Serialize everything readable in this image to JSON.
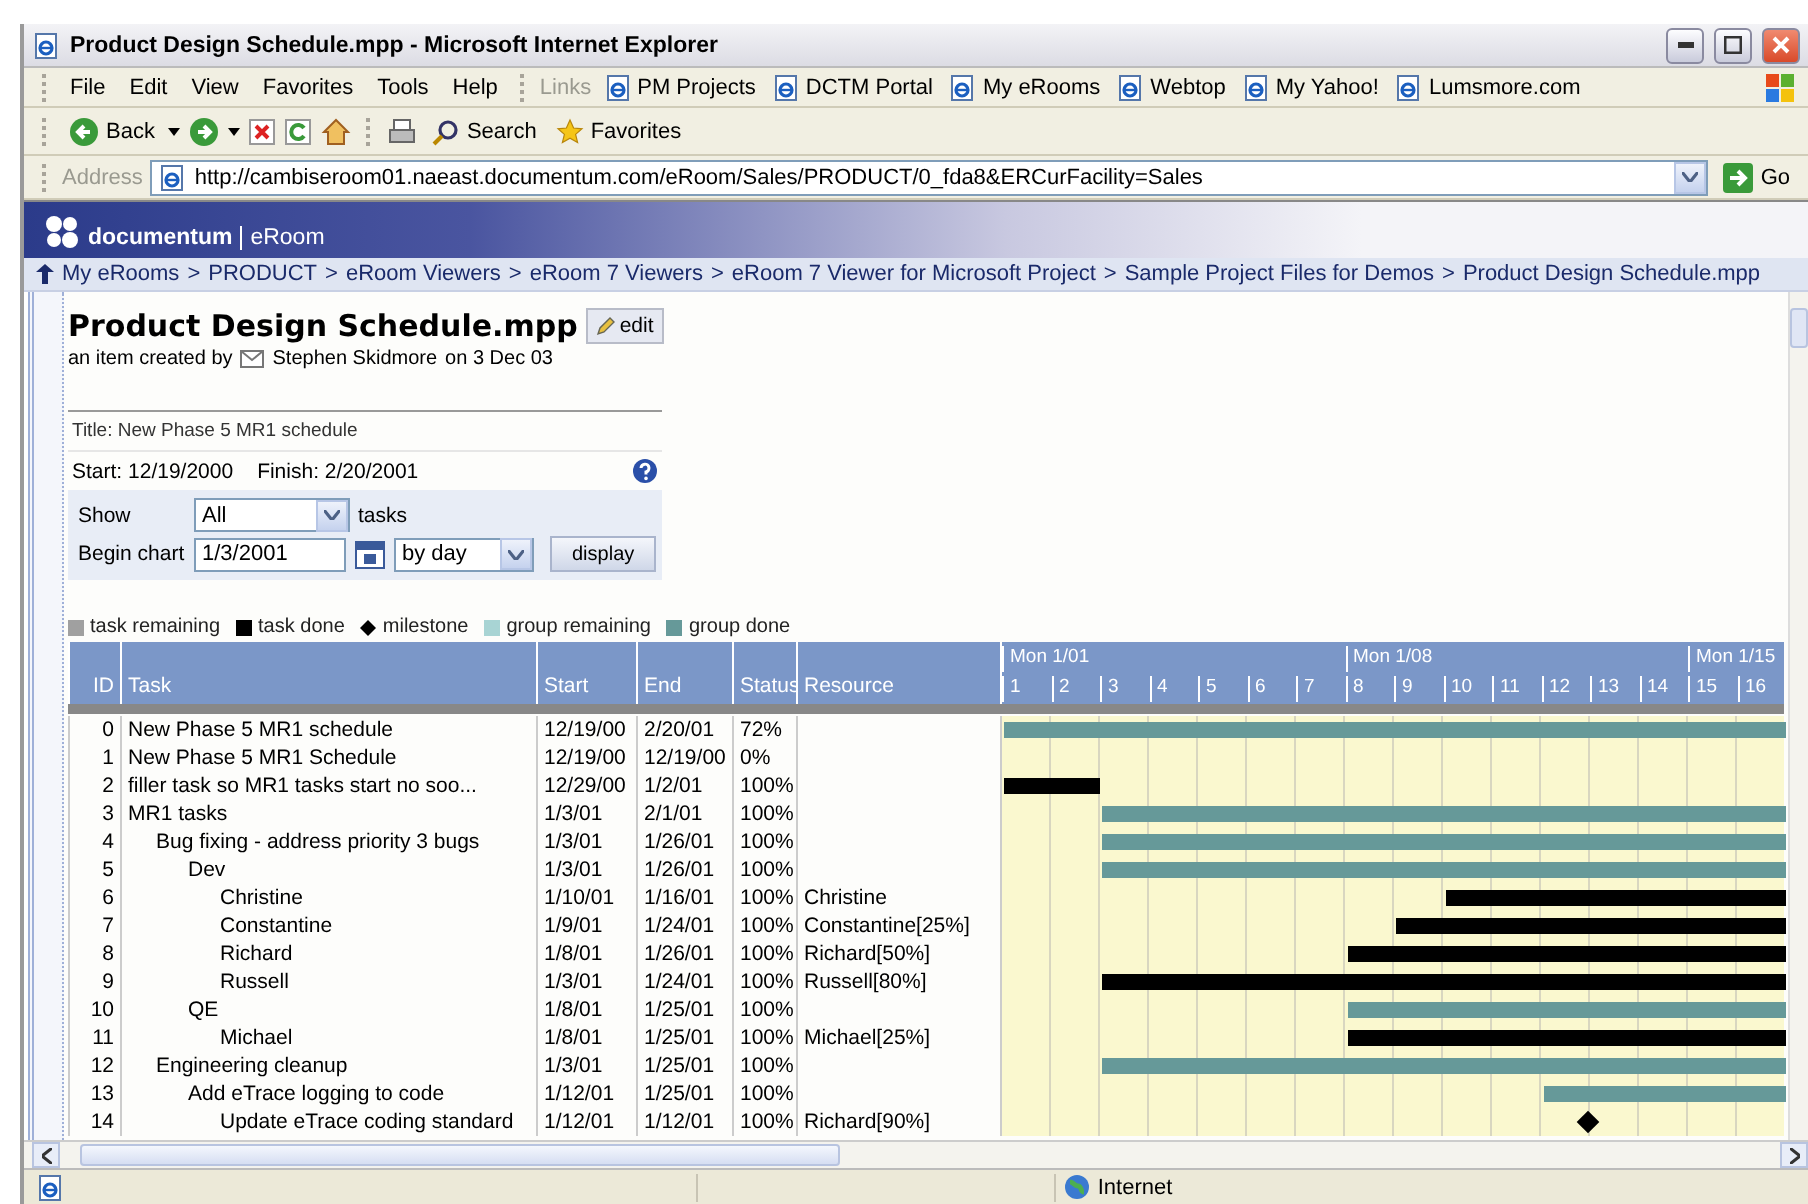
{
  "window": {
    "title": "Product Design Schedule.mpp - Microsoft Internet Explorer"
  },
  "menu": [
    "File",
    "Edit",
    "View",
    "Favorites",
    "Tools",
    "Help"
  ],
  "links": {
    "label": "Links",
    "items": [
      "PM Projects",
      "DCTM Portal",
      "My eRooms",
      "Webtop",
      "My Yahoo!",
      "Lumsmore.com"
    ]
  },
  "toolbar": {
    "back": "Back",
    "search": "Search",
    "favorites": "Favorites"
  },
  "address": {
    "label": "Address",
    "url": "http://cambiseroom01.naeast.documentum.com/eRoom/Sales/PRODUCT/0_fda8&ERCurFacility=Sales",
    "go": "Go"
  },
  "eroom": {
    "brand": "documentum",
    "product": "eRoom",
    "separator": ">",
    "breadcrumb": [
      "My eRooms",
      "PRODUCT",
      "eRoom Viewers",
      "eRoom 7 Viewers",
      "eRoom 7 Viewer for Microsoft Project",
      "Sample Project Files for Demos",
      "Product Design Schedule.mpp"
    ],
    "title": "Product Design Schedule.mpp",
    "edit": "edit",
    "created_by": "an item created by",
    "author": "Stephen Skidmore",
    "date": "on 3 Dec 03"
  },
  "project": {
    "title": "Title: New Phase 5 MR1 schedule",
    "start": "Start: 12/19/2000",
    "finish": "Finish: 2/20/2001",
    "show_label": "Show",
    "show_value": "All",
    "tasks_label": "tasks",
    "begin_label": "Begin chart",
    "begin_value": "1/3/2001",
    "scale_value": "by day",
    "display": "display"
  },
  "legend": [
    {
      "kind": "swatch",
      "label": "task remaining",
      "color": "#a0a0a0"
    },
    {
      "kind": "swatch",
      "label": "task done",
      "color": "#000000"
    },
    {
      "kind": "diamond",
      "label": "milestone",
      "color": "#000000"
    },
    {
      "kind": "swatch",
      "label": "group remaining",
      "color": "#a8d4d4"
    },
    {
      "kind": "swatch",
      "label": "group done",
      "color": "#669999"
    }
  ],
  "gantt": {
    "columns": [
      "ID",
      "Task",
      "Start",
      "End",
      "Status",
      "Resource"
    ],
    "weeks": [
      "Mon 1/01",
      "Mon 1/08",
      "Mon 1/15"
    ],
    "days": [
      "1",
      "2",
      "3",
      "4",
      "5",
      "6",
      "7",
      "8",
      "9",
      "10",
      "11",
      "12",
      "13",
      "14",
      "15",
      "16"
    ],
    "rows": [
      {
        "id": "0",
        "task": "New Phase 5 MR1 schedule",
        "start": "12/19/00",
        "end": "2/20/01",
        "status": "72%",
        "kind": "group"
      },
      {
        "id": "1",
        "task": "New Phase 5 MR1 Schedule",
        "start": "12/19/00",
        "end": "12/19/00",
        "status": "0%",
        "kind": "milestone"
      },
      {
        "id": "2",
        "task": "filler task so MR1 tasks start no soo...",
        "start": "12/29/00",
        "end": "1/2/01",
        "status": "100%",
        "kind": "task"
      },
      {
        "id": "3",
        "task": "MR1 tasks",
        "start": "1/3/01",
        "end": "2/1/01",
        "status": "100%",
        "kind": "group",
        "children": [
          {
            "id": "4",
            "task": "Bug fixing - address priority 3 bugs",
            "start": "1/3/01",
            "end": "1/26/01",
            "status": "100%",
            "kind": "group",
            "children": [
              {
                "id": "5",
                "task": "Dev",
                "start": "1/3/01",
                "end": "1/26/01",
                "status": "100%",
                "kind": "group",
                "children": [
                  {
                    "id": "6",
                    "task": "Christine",
                    "start": "1/10/01",
                    "end": "1/16/01",
                    "status": "100%",
                    "resource": "Christine",
                    "kind": "task"
                  },
                  {
                    "id": "7",
                    "task": "Constantine",
                    "start": "1/9/01",
                    "end": "1/24/01",
                    "status": "100%",
                    "resource": "Constantine[25%]",
                    "kind": "task"
                  },
                  {
                    "id": "8",
                    "task": "Richard",
                    "start": "1/8/01",
                    "end": "1/26/01",
                    "status": "100%",
                    "resource": "Richard[50%]",
                    "kind": "task"
                  },
                  {
                    "id": "9",
                    "task": "Russell",
                    "start": "1/3/01",
                    "end": "1/24/01",
                    "status": "100%",
                    "resource": "Russell[80%]",
                    "kind": "task"
                  }
                ]
              },
              {
                "id": "10",
                "task": "QE",
                "start": "1/8/01",
                "end": "1/25/01",
                "status": "100%",
                "kind": "group",
                "children": [
                  {
                    "id": "11",
                    "task": "Michael",
                    "start": "1/8/01",
                    "end": "1/25/01",
                    "status": "100%",
                    "resource": "Michael[25%]",
                    "kind": "task"
                  }
                ]
              }
            ]
          },
          {
            "id": "12",
            "task": "Engineering cleanup",
            "start": "1/3/01",
            "end": "1/25/01",
            "status": "100%",
            "kind": "group",
            "children": [
              {
                "id": "13",
                "task": "Add eTrace logging to code",
                "start": "1/12/01",
                "end": "1/25/01",
                "status": "100%",
                "kind": "group",
                "children": [
                  {
                    "id": "14",
                    "task": "Update eTrace coding standard",
                    "start": "1/12/01",
                    "end": "1/12/01",
                    "status": "100%",
                    "resource": "Richard[90%]",
                    "kind": "milestone"
                  }
                ]
              }
            ]
          }
        ]
      }
    ]
  },
  "status_bar": {
    "zone": "Internet"
  }
}
